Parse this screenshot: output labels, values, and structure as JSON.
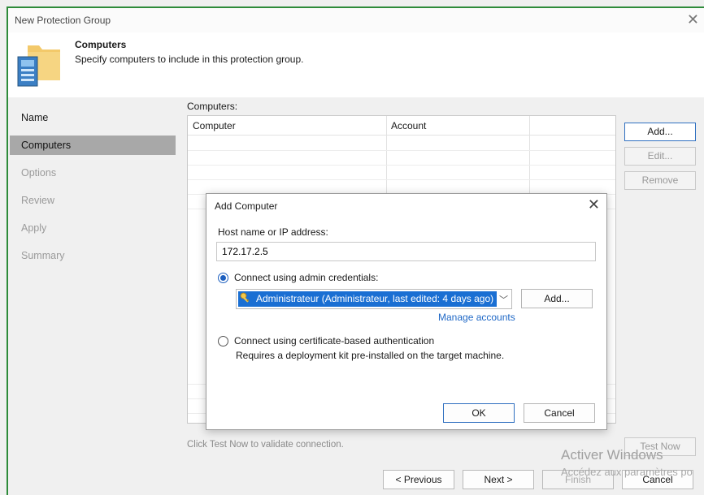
{
  "window": {
    "title": "New Protection Group"
  },
  "header": {
    "title": "Computers",
    "subtitle": "Specify computers to include in this protection group."
  },
  "nav": {
    "items": [
      {
        "label": "Name",
        "state": "done"
      },
      {
        "label": "Computers",
        "state": "active"
      },
      {
        "label": "Options",
        "state": "pending"
      },
      {
        "label": "Review",
        "state": "pending"
      },
      {
        "label": "Apply",
        "state": "pending"
      },
      {
        "label": "Summary",
        "state": "pending"
      }
    ]
  },
  "computers": {
    "label": "Computers:",
    "columns": [
      "Computer",
      "Account"
    ],
    "rows": []
  },
  "side_buttons": {
    "add": "Add...",
    "edit": "Edit...",
    "remove": "Remove",
    "test_now": "Test Now"
  },
  "hint": "Click Test Now to validate connection.",
  "footer": {
    "previous": "< Previous",
    "next": "Next >",
    "finish": "Finish",
    "cancel": "Cancel"
  },
  "watermark": {
    "line1": "Activer Windows",
    "line2": "Accédez aux paramètres po"
  },
  "dialog": {
    "title": "Add Computer",
    "host_label": "Host name or IP address:",
    "host_value": "172.17.2.5",
    "option_admin": "Connect using admin credentials:",
    "credential_selected": "Administrateur (Administrateur, last edited: 4 days ago)",
    "add_button": "Add...",
    "manage_accounts": "Manage accounts",
    "option_cert": "Connect using certificate-based authentication",
    "cert_description": "Requires a deployment kit pre-installed on the target machine.",
    "ok": "OK",
    "cancel": "Cancel",
    "selected_option": "admin"
  },
  "colors": {
    "accent": "#1a6fd3",
    "nav_active": "#a8a8a8",
    "link": "#1f68c6"
  }
}
